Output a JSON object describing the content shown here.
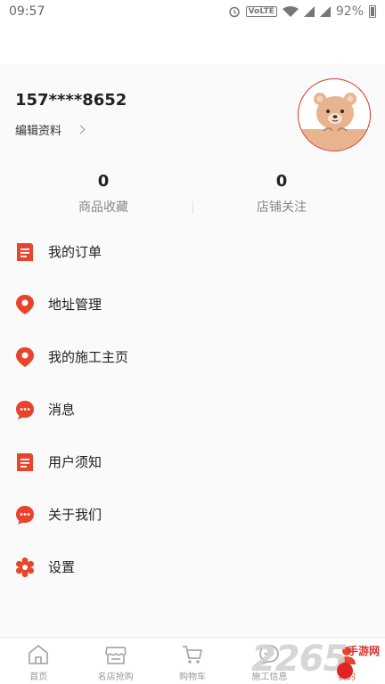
{
  "status_bar": {
    "time": "09:57",
    "volte": "VoLTE",
    "battery": "92%"
  },
  "profile": {
    "phone": "157****8652",
    "edit_label": "编辑资料"
  },
  "stats": [
    {
      "value": "0",
      "label": "商品收藏"
    },
    {
      "value": "0",
      "label": "店铺关注"
    }
  ],
  "menu": [
    {
      "label": "我的订单",
      "icon": "order-icon"
    },
    {
      "label": "地址管理",
      "icon": "location-pin-icon"
    },
    {
      "label": "我的施工主页",
      "icon": "location-pin-icon"
    },
    {
      "label": "消息",
      "icon": "message-icon"
    },
    {
      "label": "用户须知",
      "icon": "document-icon"
    },
    {
      "label": "关于我们",
      "icon": "message-icon"
    },
    {
      "label": "设置",
      "icon": "gear-icon"
    }
  ],
  "tabbar": [
    {
      "label": "首页",
      "icon": "home-icon",
      "active": false
    },
    {
      "label": "名店抢购",
      "icon": "store-icon",
      "active": false
    },
    {
      "label": "购物车",
      "icon": "cart-icon",
      "active": false
    },
    {
      "label": "施工信息",
      "icon": "chat-icon",
      "active": false
    },
    {
      "label": "我的",
      "icon": "profile-icon",
      "active": true
    }
  ],
  "watermark": {
    "number": "2265",
    "text": "手游网"
  },
  "colors": {
    "accent": "#e8442c",
    "avatar_border": "#d7342b",
    "bear": "#e8b48f"
  }
}
